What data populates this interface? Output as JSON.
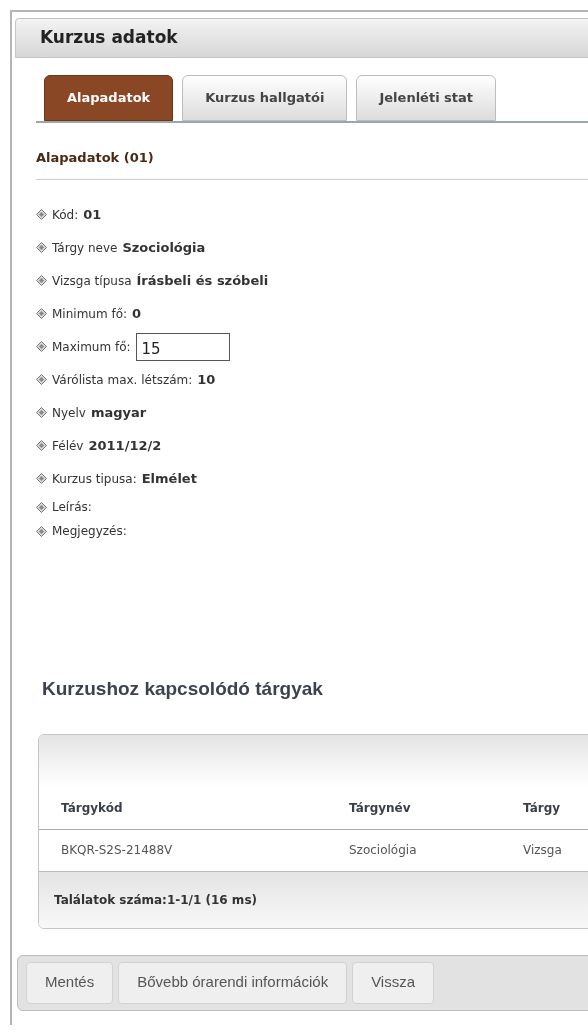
{
  "panel": {
    "title": "Kurzus adatok"
  },
  "tabs": [
    {
      "label": "Alapadatok",
      "selected": true
    },
    {
      "label": "Kurzus hallgatói",
      "selected": false
    },
    {
      "label": "Jelenléti stat",
      "selected": false
    }
  ],
  "section_title": "Alapadatok (01)",
  "fields": [
    {
      "kind": "text",
      "label": "Kód:",
      "value": "01"
    },
    {
      "kind": "text",
      "label": "Tárgy neve",
      "value": "Szociológia"
    },
    {
      "kind": "text",
      "label": "Vizsga típusa",
      "value": "Írásbeli és szóbeli"
    },
    {
      "kind": "text",
      "label": "Minimum fő:",
      "value": "0"
    },
    {
      "kind": "input",
      "label": "Maximum fő:",
      "value": "15"
    },
    {
      "kind": "text",
      "label": "Várólista max. létszám:",
      "value": "10"
    },
    {
      "kind": "text",
      "label": "Nyelv",
      "value": "magyar"
    },
    {
      "kind": "text",
      "label": "Félév",
      "value": "2011/12/2"
    },
    {
      "kind": "text",
      "label": "Kurzus tipusa:",
      "value": "Elmélet"
    },
    {
      "kind": "empty",
      "label": "Leírás:"
    },
    {
      "kind": "empty",
      "label": "Megjegyzés:"
    }
  ],
  "related": {
    "title": "Kurzushoz kapcsolódó tárgyak",
    "columns": [
      "Tárgykód",
      "Tárgynév",
      "Tárgy"
    ],
    "rows": [
      [
        "BKQR-S2S-21488V",
        "Szociológia",
        "Vizsga"
      ]
    ],
    "footer": "Találatok száma:1-1/1 (16 ms)"
  },
  "buttons": [
    "Mentés",
    "Bővebb órarendi információk",
    "Vissza"
  ]
}
